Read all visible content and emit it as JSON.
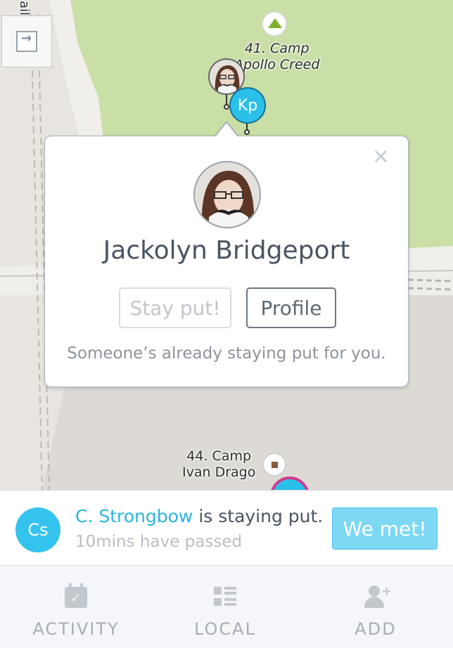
{
  "map": {
    "camp_41_label_line1": "41. Camp",
    "camp_41_label_line2": "Apollo Creed",
    "camp_44_label_line1": "44. Camp",
    "camp_44_label_line2": "Ivan Drago",
    "kp_initials": "Kp",
    "road_label": "ail",
    "colors": {
      "park": "#c9dfa6",
      "ground": "#e8e5e0",
      "pin_blue": "#2bc0ea"
    }
  },
  "popup": {
    "name": "Jackolyn Bridgeport",
    "stay_put_label": "Stay put!",
    "profile_label": "Profile",
    "note": "Someone’s already staying put for you.",
    "close_glyph": "×"
  },
  "status": {
    "initials": "Cs",
    "who": "C. Strongbow",
    "action": " is staying put.",
    "elapsed": "10mins have passed",
    "we_met_label": "We met!"
  },
  "tabs": [
    {
      "label": "ACTIVITY",
      "icon": "calendar-check-icon"
    },
    {
      "label": "LOCAL",
      "icon": "list-grid-icon"
    },
    {
      "label": "ADD",
      "icon": "add-person-icon"
    }
  ]
}
